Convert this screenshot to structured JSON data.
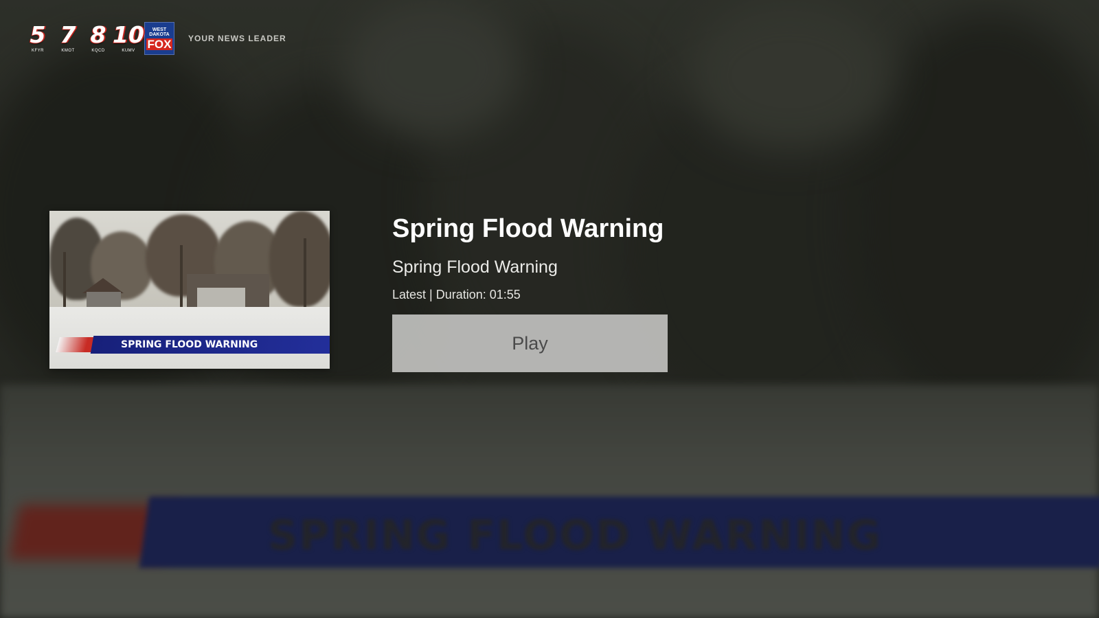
{
  "header": {
    "logo_digits": [
      "5",
      "7",
      "8",
      "10"
    ],
    "logo_calls": [
      "KFYR",
      "KMOT",
      "KQCD",
      "KUMV"
    ],
    "logo_fox_top": "WEST DAKOTA",
    "logo_fox_label": "FOX",
    "tagline": "YOUR NEWS LEADER"
  },
  "thumbnail": {
    "banner_text": "SPRING FLOOD WARNING"
  },
  "background": {
    "banner_text": "SPRING FLOOD WARNING"
  },
  "video": {
    "title": "Spring Flood Warning",
    "description": "Spring Flood Warning",
    "meta": "Latest | Duration: 01:55",
    "play_label": "Play"
  },
  "colors": {
    "banner_blue": "#1c2567",
    "banner_red": "#c82b24",
    "play_button_bg": "#c8c8c6",
    "text_primary": "#ffffff"
  }
}
